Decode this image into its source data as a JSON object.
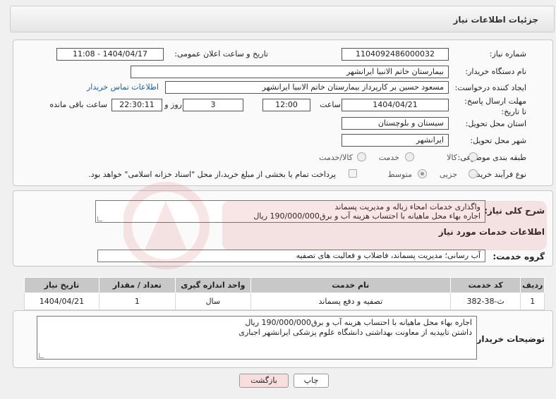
{
  "header": {
    "title": "جزئیات اطلاعات نیاز"
  },
  "form": {
    "need_number_label": "شماره نیاز:",
    "need_number": "1104092486000032",
    "announce_label": "تاریخ و ساعت اعلان عمومی:",
    "announce_value": "1404/04/17 - 11:08",
    "buyer_org_label": "نام دستگاه خریدار:",
    "buyer_org": "بیمارستان خاتم الانبیا ایرانشهر",
    "creator_label": "ایجاد کننده درخواست:",
    "creator": "مسعود حسین بر کارپرداز بیمارستان خاتم الانبیا ایرانشهر",
    "contact_link": "اطلاعات تماس خریدار",
    "deadline_label": "مهلت ارسال پاسخ: تا تاریخ:",
    "deadline_date": "1404/04/21",
    "time_label": "ساعت",
    "deadline_time": "12:00",
    "days_value": "3",
    "days_label": "روز و",
    "remaining_time": "22:30:11",
    "remaining_label": "ساعت باقی مانده",
    "province_label": "استان محل تحویل:",
    "province": "سیستان و بلوچستان",
    "city_label": "شهر محل تحویل:",
    "city": "ایرانشهر",
    "category_label": "طبقه بندی موضوعی:",
    "category_options": [
      "کالا",
      "خدمت",
      "کالا/خدمت"
    ],
    "process_label": "نوع فرآیند خرید :",
    "process_options": [
      "جزیی",
      "متوسط"
    ],
    "payment_note": "پرداخت تمام یا بخشی از مبلغ خرید،از محل \"اسناد خزانه اسلامی\" خواهد بود."
  },
  "summary": {
    "label": "شرح کلی نیاز:",
    "line1": "واگذاری خدمات امحاء زباله و مدیریت پسماند",
    "line2": "اجاره بهاء محل ماهیانه  با احتساب هزینه آب و برق190/000/000 ریال"
  },
  "services": {
    "heading": "اطلاعات خدمات مورد نیاز",
    "group_label": "گروه خدمت:",
    "group_value": "آب رسانی؛ مدیریت پسماند، فاضلاب و فعالیت های تصفیه",
    "columns": [
      "ردیف",
      "کد خدمت",
      "نام خدمت",
      "واحد اندازه گیری",
      "تعداد / مقدار",
      "تاریخ نیاز"
    ],
    "rows": [
      [
        "1",
        "ث-38-382",
        "تصفیه و دفع پسماند",
        "سال",
        "1",
        "1404/04/21"
      ]
    ]
  },
  "buyer_notes": {
    "label": "توضیحات خریدار:",
    "line1": "اجاره بهاء محل ماهیانه  با احتساب هزینه آب و برق190/000/000 ریال",
    "line2": "داشتن تاییدیه از معاونت بهداشتی دانشگاه علوم پزشکی ایرانشهر اجباری"
  },
  "buttons": {
    "print": "چاپ",
    "back": "بازگشت"
  },
  "colors": {
    "accent": "#1a5ea8",
    "header_gray": "#c8c8c8",
    "back_button": "#f9dede"
  }
}
